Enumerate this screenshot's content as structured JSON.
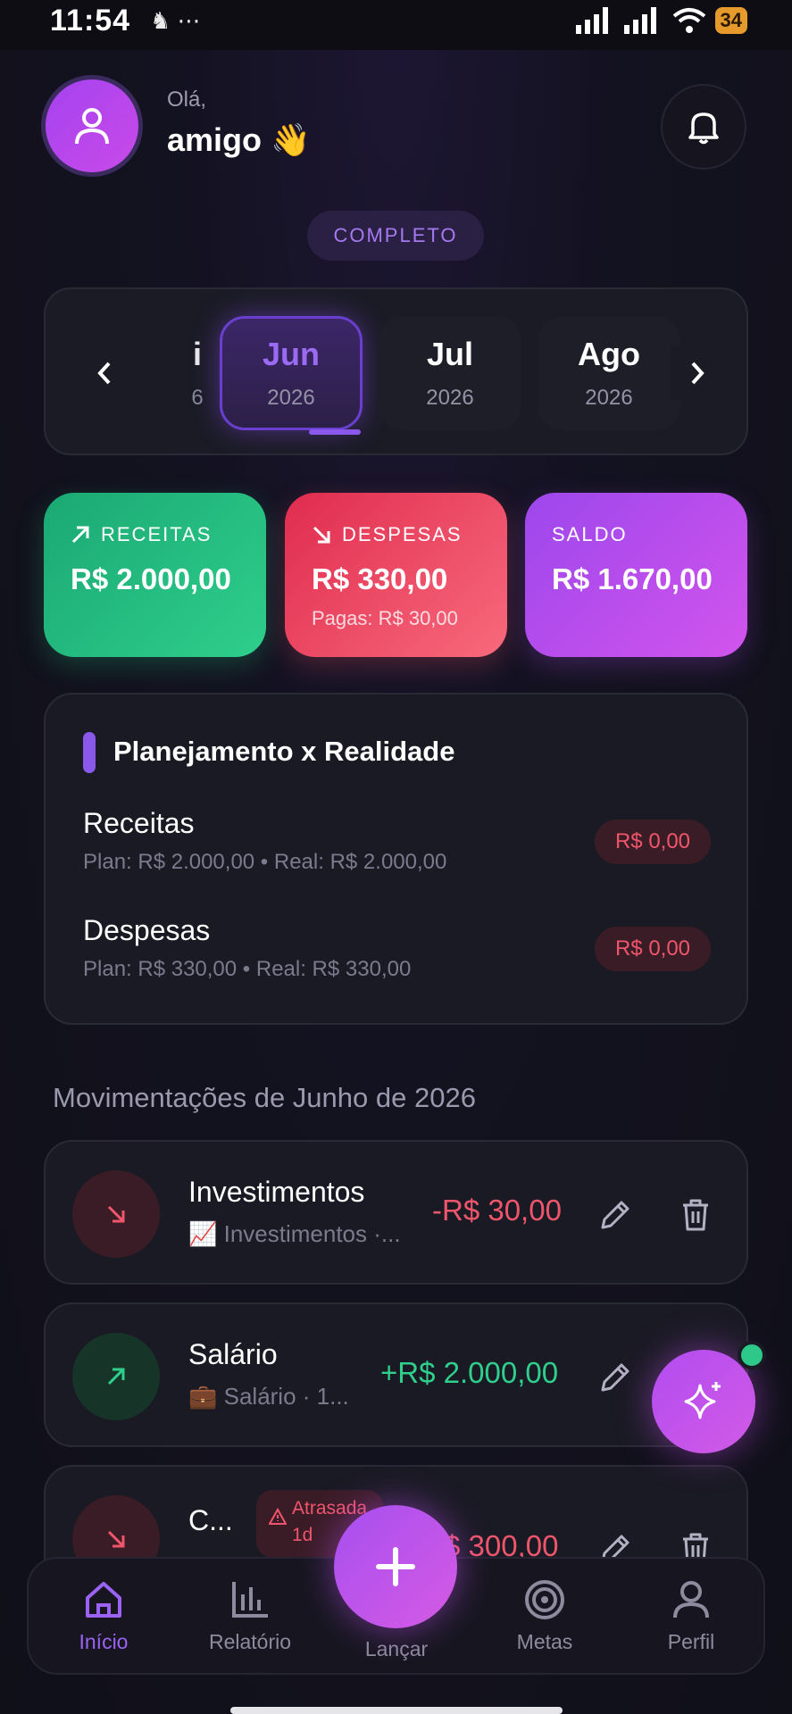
{
  "status": {
    "time": "11:54",
    "left_icons": "♞ ⋯",
    "battery": "34"
  },
  "header": {
    "greeting": "Olá,",
    "name": "amigo",
    "emoji": "👋"
  },
  "plan_badge": "COMPLETO",
  "months": [
    {
      "name": "i",
      "year": "6"
    },
    {
      "name": "Jun",
      "year": "2026"
    },
    {
      "name": "Jul",
      "year": "2026"
    },
    {
      "name": "Ago",
      "year": "2026"
    }
  ],
  "summary": {
    "receitas": {
      "label": "RECEITAS",
      "value": "R$ 2.000,00",
      "color": "#23c07f"
    },
    "despesas": {
      "label": "DESPESAS",
      "value": "R$ 330,00",
      "sub": "Pagas: R$ 30,00",
      "color": "#f0566b"
    },
    "saldo": {
      "label": "SALDO",
      "value": "R$ 1.670,00",
      "color": "#b24cf0"
    }
  },
  "planning": {
    "title": "Planejamento x Realidade",
    "rows": [
      {
        "label": "Receitas",
        "sub": "Plan: R$ 2.000,00 • Real: R$ 2.000,00",
        "diff": "R$ 0,00"
      },
      {
        "label": "Despesas",
        "sub": "Plan: R$ 330,00 • Real: R$ 330,00",
        "diff": "R$ 0,00"
      }
    ]
  },
  "section_title": "Movimentações de Junho de 2026",
  "transactions": [
    {
      "title": "Investimentos",
      "emoji": "📈",
      "sub": "Investimentos ·...",
      "amount": "-R$ 30,00",
      "type": "expense"
    },
    {
      "title": "Salário",
      "emoji": "💼",
      "sub": "Salário · 1...",
      "amount": "+R$ 2.000,00",
      "type": "income"
    },
    {
      "title": "C...",
      "badge": "Atrasada\n1d",
      "amount": "$ 300,00",
      "type": "expense"
    }
  ],
  "nav": {
    "inicio": "Início",
    "relatorio": "Relatório",
    "lancar": "Lançar",
    "metas": "Metas",
    "perfil": "Perfil"
  }
}
